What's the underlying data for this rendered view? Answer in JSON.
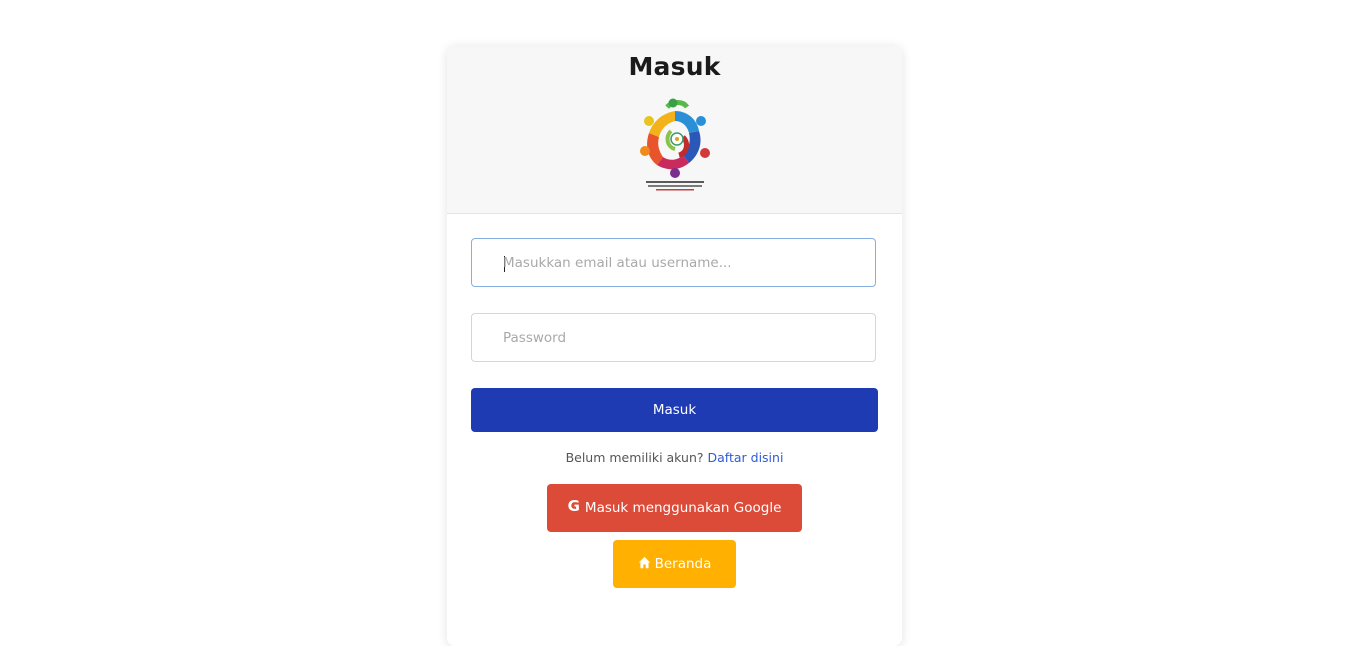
{
  "login": {
    "title": "Masuk",
    "logo_alt": "brand-logo",
    "email_placeholder": "Masukkan email atau username...",
    "email_value": "",
    "password_placeholder": "Password",
    "password_value": "",
    "submit_label": "Masuk",
    "register_prompt": "Belum memiliki akun?",
    "register_link": "Daftar disini",
    "google_button": "Masuk menggunakan Google",
    "google_icon": "google-g-icon",
    "home_button": "Beranda",
    "home_icon": "home-icon"
  },
  "colors": {
    "primary": "#1e3bb3",
    "google": "#dc4a38",
    "home": "#ffb000",
    "link": "#2f5bd8",
    "header_bg": "#f7f7f7"
  }
}
